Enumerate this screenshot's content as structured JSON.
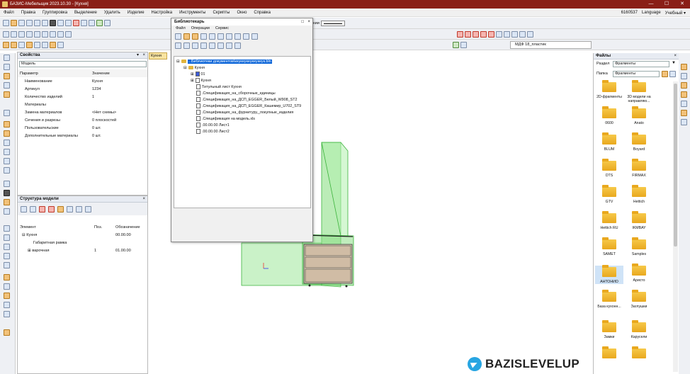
{
  "window": {
    "title": "БАЗИС-Мебельщик 2023.10.30 - [Кухня]",
    "min": "—",
    "max": "☐",
    "close": "✕"
  },
  "menubar": {
    "items": [
      "Файл",
      "Правка",
      "Группировка",
      "Выделение",
      "Удалить",
      "Изделие",
      "Настройка",
      "Инструменты",
      "Скрипты",
      "Окно",
      "Справка"
    ],
    "right": [
      "6160537",
      "Language",
      "Учебный ▾"
    ]
  },
  "toolbar": {
    "line_color_label": "Цвет линии",
    "material_label": "МДФ 18_пластик"
  },
  "properties": {
    "title": "Свойства",
    "selector": "Модель",
    "head": [
      "Параметр",
      "Значение"
    ],
    "rows": [
      [
        "Наименование",
        "Кухня"
      ],
      [
        "Артикул",
        "1234"
      ],
      [
        "Количество изделий",
        "1"
      ],
      [
        "Материалы",
        ""
      ],
      [
        "Замена материалов",
        "<Нет схемы>"
      ],
      [
        "Сечения и разрезы",
        "0 плоскостей"
      ],
      [
        "Пользовательские",
        "0 шт."
      ],
      [
        "Дополнительные материалы",
        "0 шт."
      ]
    ]
  },
  "structure": {
    "title": "Структура модели",
    "head": [
      "Элемент",
      "Поз.",
      "Обозначение"
    ],
    "rows": [
      {
        "name": "Кухня",
        "pos": "",
        "code": "00.00.00"
      },
      {
        "name": "Габаритная рамка",
        "pos": "",
        "code": ""
      },
      {
        "name": "варочная",
        "pos": "1",
        "code": "01.00.00"
      }
    ]
  },
  "doc_tab": "Кухня",
  "library": {
    "title": "Библиотекарь",
    "menus": [
      "Файл",
      "Операции",
      "Сервис"
    ],
    "root": "...Библиотеки документов\\кеукеукеукеукеук.bln",
    "kitchen": "Кухня",
    "items": [
      "01",
      "Кухня",
      "Титульный лист Кухня",
      ".Спецификация_на_сборочные_единицы",
      ".Спецификация_на_ДСП_EGGER_Белый_W908_ST2",
      ".Спецификация_на_ДСП_EGGER_Кашемир_U702_ST9",
      ".Спецификация_на_фурнитуру,_покупные_изделия",
      ".Спецификация на модель.xls",
      ".00.00.00 Лист1",
      ".00.00.00 Лист2"
    ]
  },
  "files": {
    "title": "Файлы",
    "section_label": "Раздел",
    "section_value": "Фрагменты",
    "folder_label": "Папка",
    "folder_value": "Фрагменты",
    "items": [
      "2D-фрагменты",
      "3D модели на направляю...",
      "0600",
      "Anato",
      "BLUM",
      "Boyard",
      "DTS",
      "FIRMAX",
      "GTV",
      "Hettich",
      "Hettich RU",
      "IKMBAY",
      "SAMET",
      "Samples",
      "АНТОНИО",
      "Аристо",
      "База кухонн...",
      "Заглушки",
      "Замки",
      "Карусели"
    ],
    "selected": "АНТОНИО"
  },
  "brand": "BAZISLEVELUP",
  "colors": {
    "titlebar": "#8a1f17",
    "selection": "#0a64d8",
    "green_box": "#7fe07a"
  }
}
